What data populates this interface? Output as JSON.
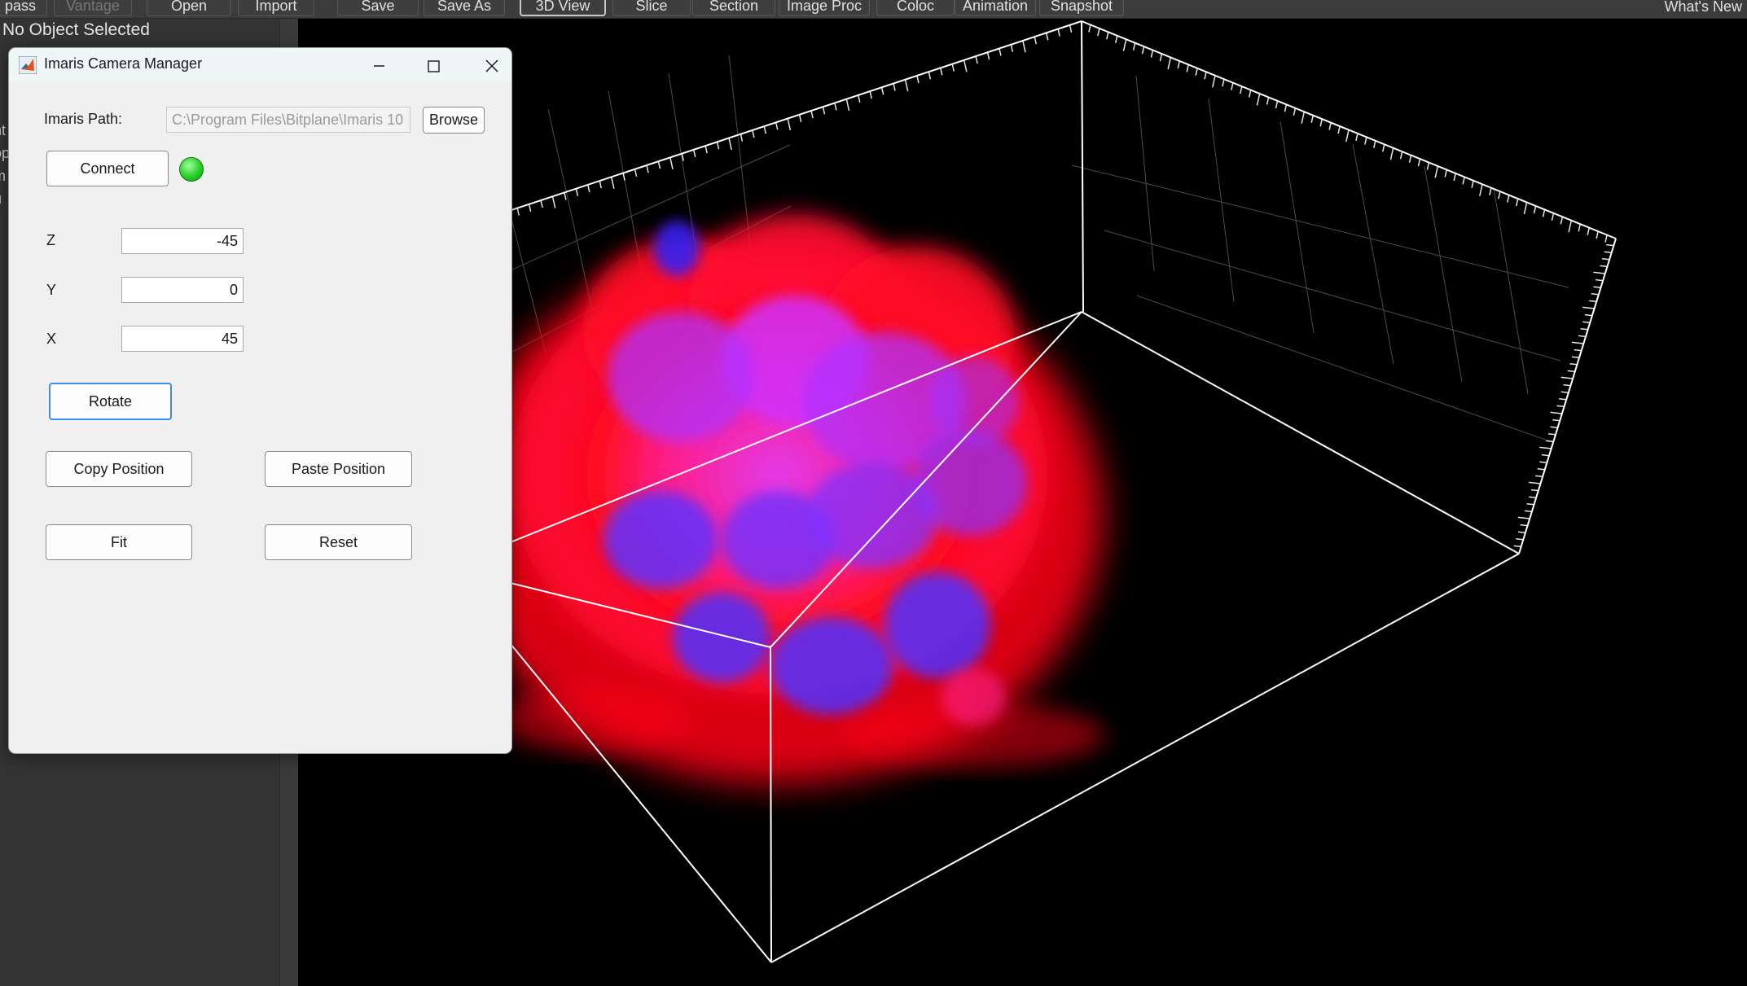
{
  "toolbar": {
    "items": [
      {
        "label": "pass",
        "state": "normal"
      },
      {
        "label": "Vantage",
        "state": "disabled"
      },
      {
        "label": "Open",
        "state": "normal"
      },
      {
        "label": "Import",
        "state": "normal"
      },
      {
        "label": "Save",
        "state": "normal"
      },
      {
        "label": "Save As",
        "state": "normal"
      },
      {
        "label": "3D View",
        "state": "active"
      },
      {
        "label": "Slice",
        "state": "normal"
      },
      {
        "label": "Section",
        "state": "normal"
      },
      {
        "label": "Image Proc",
        "state": "normal"
      },
      {
        "label": "Coloc",
        "state": "normal"
      },
      {
        "label": "Animation",
        "state": "normal"
      },
      {
        "label": "Snapshot",
        "state": "normal"
      }
    ],
    "whats_new": "What's New"
  },
  "left_panel": {
    "selection_status": "No Object Selected",
    "clipped_labels": [
      "nt",
      "op",
      "m",
      "u"
    ]
  },
  "dialog": {
    "title": "Imaris Camera Manager",
    "path_label": "Imaris Path:",
    "path_value": "C:\\Program Files\\Bitplane\\Imaris 10",
    "browse_label": "Browse",
    "connect_label": "Connect",
    "connection_status_color": "#22cc22",
    "z_label": "Z",
    "z_value": "-45",
    "y_label": "Y",
    "y_value": "0",
    "x_label": "X",
    "x_value": "45",
    "rotate_label": "Rotate",
    "copy_position_label": "Copy Position",
    "paste_position_label": "Paste Position",
    "fit_label": "Fit",
    "reset_label": "Reset"
  },
  "viewport": {
    "background": "#000000",
    "bounding_box_color": "#ffffff",
    "channel_colors": [
      "#ff1020",
      "#4020ff"
    ]
  }
}
